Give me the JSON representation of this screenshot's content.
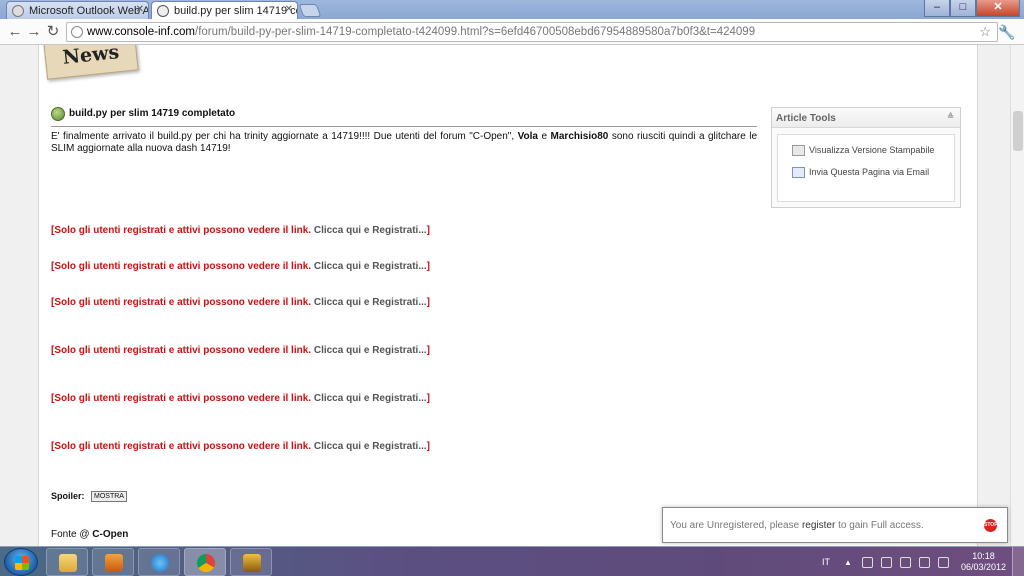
{
  "browser": {
    "tabs": [
      {
        "title": "Microsoft Outlook Web Ac",
        "active": false
      },
      {
        "title": "build.py per slim 14719 cor",
        "active": true
      }
    ],
    "window_buttons": {
      "minimize": "–",
      "maximize": "□",
      "close": "✕"
    },
    "url_host": "www.console-inf.com",
    "url_path": "/forum/build-py-per-slim-14719-completato-t424099.html?s=6efd46700508ebd67954889580a7b0f3&t=424099"
  },
  "page": {
    "news_badge": "News",
    "article_title": "build.py per slim 14719 completato",
    "body_part1": "E' finalmente arrivato il build.py per chi ha trinity aggiornate a 14719!!!! Due utenti del forum \"C-Open\",",
    "body_name1": "Vola",
    "body_e": "e",
    "body_name2": "Marchisio80",
    "body_part2": "sono riusciti quindi a glitchare le SLIM aggiornate alla nuova dash 14719!",
    "link_notice_red": "[Solo gli utenti registrati e attivi possono vedere il link.",
    "link_notice_gray": "Clicca qui e Registrati...",
    "link_notice_end": "]",
    "spoiler_label": "Spoiler:",
    "spoiler_button": "MOSTRA",
    "fonte_label": "Fonte @",
    "fonte_value": "C-Open"
  },
  "article_tools": {
    "title": "Article Tools",
    "items": [
      "Visualizza Versione Stampabile",
      "Invia Questa Pagina via Email"
    ]
  },
  "toast": {
    "text_before": "You are Unregistered, please",
    "link": "register",
    "text_after": "to gain Full access.",
    "stop_label": "STOP"
  },
  "taskbar": {
    "language": "IT",
    "time": "10:18",
    "date": "06/03/2012"
  },
  "colors": {
    "link_red": "#cc1111",
    "link_gray": "#555555",
    "taskbar": "#5b4f82"
  }
}
